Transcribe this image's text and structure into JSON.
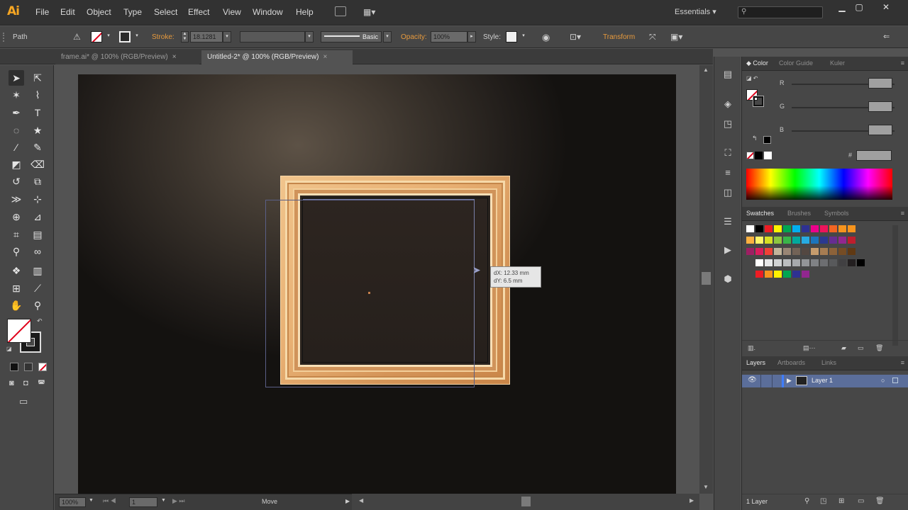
{
  "app": {
    "logo": "Ai"
  },
  "menu": {
    "items": [
      "File",
      "Edit",
      "Object",
      "Type",
      "Select",
      "Effect",
      "View",
      "Window",
      "Help"
    ],
    "workspace": "Essentials"
  },
  "control_bar": {
    "selection": "Path",
    "stroke_label": "Stroke:",
    "stroke_value": "18.1281",
    "style_line": "Basic",
    "opacity_label": "Opacity:",
    "opacity_value": "100%",
    "style_label": "Style:",
    "transform_label": "Transform"
  },
  "tabs": [
    {
      "label": "frame.ai* @ 100% (RGB/Preview)",
      "active": false
    },
    {
      "label": "Untitled-2* @ 100% (RGB/Preview)",
      "active": true
    }
  ],
  "canvas": {
    "tooltip_line1": "dX: 12.33 mm",
    "tooltip_line2": "dY: 6.5 mm"
  },
  "color_panel": {
    "tabs": [
      "Color",
      "Color Guide",
      "Kuler"
    ],
    "channels": [
      "R",
      "G",
      "B"
    ],
    "hex_prefix": "#"
  },
  "swatches_panel": {
    "tabs": [
      "Swatches",
      "Brushes",
      "Symbols"
    ],
    "row1": [
      "#ffffff",
      "#000000",
      "#ed1c24",
      "#fff200",
      "#00a651",
      "#00aeef",
      "#2e3192",
      "#ec008c",
      "#ed145b",
      "#f26522",
      "#f7941d",
      "#f7941d"
    ],
    "row2": [
      "#fbb040",
      "#fff568",
      "#d7df23",
      "#8dc63f",
      "#39b54a",
      "#00a99d",
      "#27aae1",
      "#1c75bc",
      "#2b3990",
      "#662d91",
      "#92278f",
      "#be1e2d"
    ],
    "row3": [
      "#9e1f63",
      "#da1c5c",
      "#ef4136",
      "#c2b59b",
      "#998675",
      "#736357",
      "#534741",
      "#c69c6d",
      "#a67c52",
      "#8c6239",
      "#754c24",
      "#603913"
    ],
    "row4": [
      "#ffffff",
      "#e6e7e8",
      "#d1d3d4",
      "#bcbec0",
      "#a7a9ac",
      "#939598",
      "#808285",
      "#6d6e71",
      "#58595b",
      "#414042",
      "#231f20",
      "#000000"
    ],
    "row5": [
      "#ed1c24",
      "#f7941d",
      "#fff200",
      "#00a651",
      "#2e3192",
      "#92278f"
    ]
  },
  "layers_panel": {
    "tabs": [
      "Layers",
      "Artboards",
      "Links"
    ],
    "layer_name": "Layer 1",
    "footer": "1 Layer"
  },
  "status_bar": {
    "zoom": "100%",
    "artboard_num": "1",
    "mode": "Move"
  }
}
